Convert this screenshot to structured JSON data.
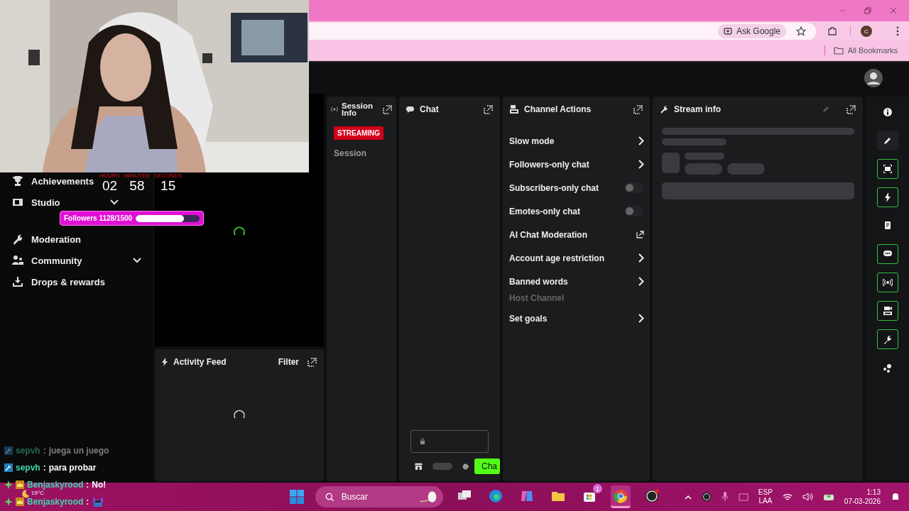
{
  "browser": {
    "ask_google": "Ask Google",
    "bookmarks": "All Bookmarks",
    "profile_initial": "C"
  },
  "sidebar": {
    "items": [
      {
        "label": "Achievements",
        "kind": "link"
      },
      {
        "label": "Studio",
        "kind": "group"
      },
      {
        "label": "Moderation",
        "kind": "link"
      },
      {
        "label": "Community",
        "kind": "group"
      },
      {
        "label": "Drops & rewards",
        "kind": "link"
      }
    ]
  },
  "timer": {
    "labels": [
      "HOURS",
      "MINUTES",
      "SECONDS"
    ],
    "values": [
      "02",
      "58",
      "15"
    ]
  },
  "followers_goal": {
    "label": "Followers 1128/1500",
    "level": 0.76
  },
  "session_info": {
    "title": "Session Info",
    "badge": "STREAMING",
    "session_label": "Session"
  },
  "chat_panel": {
    "title": "Chat",
    "send_button": "Cha"
  },
  "channel_actions": {
    "title": "Channel Actions",
    "items": [
      {
        "label": "Slow mode",
        "kind": "submenu"
      },
      {
        "label": "Followers-only chat",
        "kind": "submenu"
      },
      {
        "label": "Subscribers-only chat",
        "kind": "toggle",
        "on": false
      },
      {
        "label": "Emotes-only chat",
        "kind": "toggle",
        "on": false
      },
      {
        "label": "AI Chat Moderation",
        "kind": "external"
      },
      {
        "label": "Account age restriction",
        "kind": "submenu"
      },
      {
        "label": "Banned words",
        "kind": "submenu"
      },
      {
        "label": "Host Channel",
        "kind": "disabled"
      },
      {
        "label": "Set goals",
        "kind": "submenu"
      }
    ]
  },
  "stream_info": {
    "title": "Stream info"
  },
  "activity_feed": {
    "title": "Activity Feed",
    "filter": "Filter"
  },
  "rail": [
    {
      "highlighted": false
    },
    {
      "highlighted": false
    },
    {
      "highlighted": true
    },
    {
      "highlighted": true
    },
    {
      "highlighted": false
    },
    {
      "highlighted": true
    },
    {
      "highlighted": true
    },
    {
      "highlighted": true
    },
    {
      "highlighted": true
    },
    {
      "highlighted": false
    }
  ],
  "chat_overlay": {
    "messages": [
      {
        "user": "sepvh",
        "kind": "moderator",
        "separator": ":",
        "text": "juega un juego",
        "faded": true
      },
      {
        "user": "sepvh",
        "kind": "moderator",
        "separator": ":",
        "text": "para probar",
        "faded": false
      },
      {
        "user": "Benjaskyrood",
        "kind": "subscriber",
        "separator": ":",
        "text": "No!",
        "faded": false
      },
      {
        "user": "Benjaskyrood",
        "kind": "subscriber",
        "separator": ":",
        "faded": false
      }
    ]
  },
  "weather": {
    "temperature": "19°C"
  },
  "taskbar": {
    "search_placeholder": "Buscar",
    "store_badge": "1",
    "language": [
      "ESP",
      "LAA"
    ],
    "time": "1:13",
    "date": "07-03-2026",
    "apps": [
      {
        "selected": false
      },
      {
        "selected": false
      },
      {
        "selected": false
      },
      {
        "selected": false
      },
      {
        "selected": false
      },
      {
        "selected": true
      },
      {
        "selected": false
      }
    ]
  }
}
